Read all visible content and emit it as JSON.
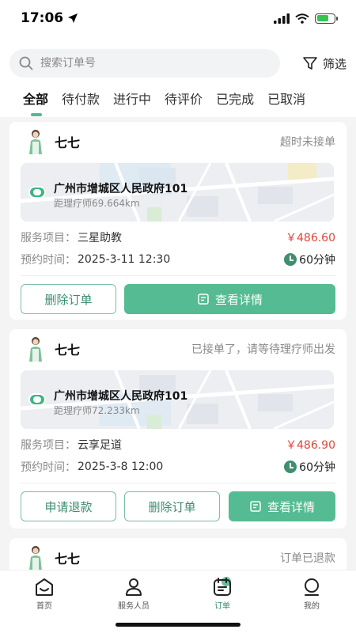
{
  "status_bar": {
    "time": "17:06"
  },
  "search": {
    "placeholder": "搜索订单号",
    "filter_label": "筛选"
  },
  "tabs": [
    {
      "label": "全部",
      "active": true
    },
    {
      "label": "待付款"
    },
    {
      "label": "进行中"
    },
    {
      "label": "待评价"
    },
    {
      "label": "已完成"
    },
    {
      "label": "已取消"
    }
  ],
  "orders": [
    {
      "therapist": "七七",
      "status": "超时未接单",
      "address": "广州市增城区人民政府101",
      "distance": "距理疗师69.664km",
      "service_label": "服务项目：",
      "service": "三星助教",
      "price": "￥486.60",
      "time_label": "预约时间：",
      "time": "2025-3-11 12:30",
      "duration": "60分钟",
      "buttons": [
        "删除订单",
        "查看详情"
      ]
    },
    {
      "therapist": "七七",
      "status": "已接单了，请等待理疗师出发",
      "address": "广州市增城区人民政府101",
      "distance": "距理疗师72.233km",
      "service_label": "服务项目：",
      "service": "云享足道",
      "price": "￥486.90",
      "time_label": "预约时间：",
      "time": "2025-3-8 12:00",
      "duration": "60分钟",
      "buttons": [
        "申请退款",
        "删除订单",
        "查看详情"
      ]
    },
    {
      "therapist": "七七",
      "status": "订单已退款"
    }
  ],
  "tabbar": [
    {
      "label": "首页",
      "icon": "home-icon"
    },
    {
      "label": "服务人员",
      "icon": "person-icon"
    },
    {
      "label": "订单",
      "icon": "order-icon",
      "active": true
    },
    {
      "label": "我的",
      "icon": "profile-icon"
    }
  ],
  "colors": {
    "accent": "#55bb92",
    "price": "#e0463a"
  }
}
